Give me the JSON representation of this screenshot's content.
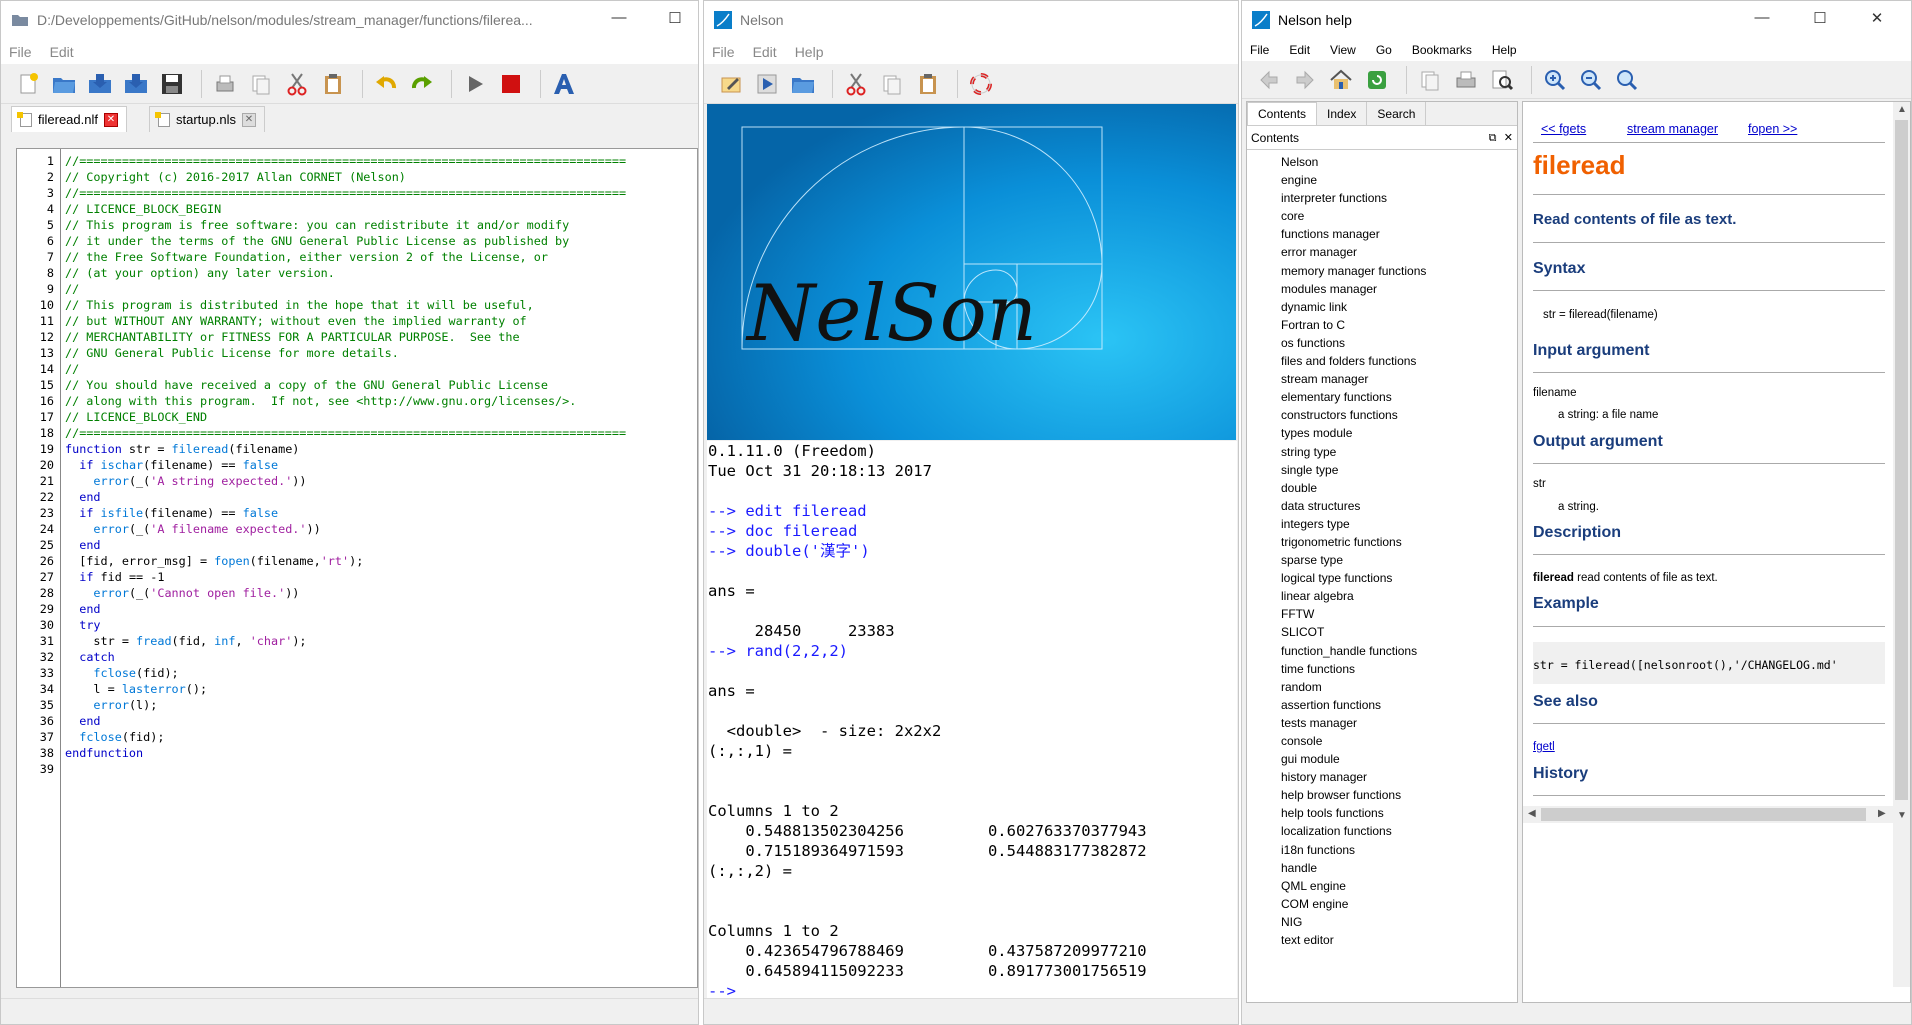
{
  "editor": {
    "title": "D:/Developpements/GitHub/nelson/modules/stream_manager/functions/filerea...",
    "menu": [
      "File",
      "Edit"
    ],
    "tabs": [
      {
        "label": "fileread.nlf",
        "active": true
      },
      {
        "label": "startup.nls",
        "active": false
      }
    ],
    "line_numbers": [
      "1",
      "2",
      "3",
      "4",
      "5",
      "6",
      "7",
      "8",
      "9",
      "10",
      "11",
      "12",
      "13",
      "14",
      "15",
      "16",
      "17",
      "18",
      "19",
      "20",
      "21",
      "22",
      "23",
      "24",
      "25",
      "26",
      "27",
      "28",
      "29",
      "30",
      "31",
      "32",
      "33",
      "34",
      "35",
      "36",
      "37",
      "38",
      "39"
    ],
    "code_lines": [
      "//=============================================================================",
      "// Copyright (c) 2016-2017 Allan CORNET (Nelson)",
      "//=============================================================================",
      "// LICENCE_BLOCK_BEGIN",
      "// This program is free software: you can redistribute it and/or modify",
      "// it under the terms of the GNU General Public License as published by",
      "// the Free Software Foundation, either version 2 of the License, or",
      "// (at your option) any later version.",
      "//",
      "// This program is distributed in the hope that it will be useful,",
      "// but WITHOUT ANY WARRANTY; without even the implied warranty of",
      "// MERCHANTABILITY or FITNESS FOR A PARTICULAR PURPOSE.  See the",
      "// GNU General Public License for more details.",
      "//",
      "// You should have received a copy of the GNU General Public License",
      "// along with this program.  If not, see <http://www.gnu.org/licenses/>.",
      "// LICENCE_BLOCK_END",
      "//=============================================================================",
      "function str = fileread(filename)",
      "  if ischar(filename) == false",
      "    error(_('A string expected.'))",
      "  end",
      "  if isfile(filename) == false",
      "    error(_('A filename expected.'))",
      "  end",
      "  [fid, error_msg] = fopen(filename,'rt');",
      "  if fid == -1",
      "    error(_('Cannot open file.'))",
      "  end",
      "  try",
      "    str = fread(fid, inf, 'char');",
      "  catch",
      "    fclose(fid);",
      "    l = lasterror();",
      "    error(l);",
      "  end",
      "  fclose(fid);",
      "endfunction",
      ""
    ]
  },
  "console": {
    "title": "Nelson",
    "menu": [
      "File",
      "Edit",
      "Help"
    ],
    "banner_text": "NelSon",
    "lines": [
      {
        "t": "0.1.11.0 (Freedom)",
        "p": false
      },
      {
        "t": "Tue Oct 31 20:18:13 2017",
        "p": false
      },
      {
        "t": "",
        "p": false
      },
      {
        "t": "--> edit fileread",
        "p": true
      },
      {
        "t": "--> doc fileread",
        "p": true
      },
      {
        "t": "--> double('漢字')",
        "p": true
      },
      {
        "t": "",
        "p": false
      },
      {
        "t": "ans =",
        "p": false
      },
      {
        "t": "",
        "p": false
      },
      {
        "t": "     28450     23383",
        "p": false
      },
      {
        "t": "--> rand(2,2,2)",
        "p": true
      },
      {
        "t": "",
        "p": false
      },
      {
        "t": "ans =",
        "p": false
      },
      {
        "t": "",
        "p": false
      },
      {
        "t": "  <double>  - size: 2x2x2",
        "p": false
      },
      {
        "t": "(:,:,1) =",
        "p": false
      },
      {
        "t": "",
        "p": false
      },
      {
        "t": "",
        "p": false
      },
      {
        "t": "Columns 1 to 2",
        "p": false
      },
      {
        "t": "    0.548813502304256         0.602763370377943",
        "p": false
      },
      {
        "t": "    0.715189364971593         0.544883177382872",
        "p": false
      },
      {
        "t": "(:,:,2) =",
        "p": false
      },
      {
        "t": "",
        "p": false
      },
      {
        "t": "",
        "p": false
      },
      {
        "t": "Columns 1 to 2",
        "p": false
      },
      {
        "t": "    0.423654796788469         0.437587209977210",
        "p": false
      },
      {
        "t": "    0.645894115092233         0.891773001756519",
        "p": false
      },
      {
        "t": "-->",
        "p": true
      }
    ]
  },
  "help": {
    "title": "Nelson help",
    "menu": [
      "File",
      "Edit",
      "View",
      "Go",
      "Bookmarks",
      "Help"
    ],
    "tabs": [
      "Contents",
      "Index",
      "Search"
    ],
    "contents_header": "Contents",
    "contents": [
      "Nelson",
      "engine",
      "interpreter functions",
      "core",
      "functions manager",
      "error manager",
      "memory manager functions",
      "modules manager",
      "dynamic link",
      "Fortran to C",
      "os functions",
      "files and folders functions",
      "stream manager",
      "elementary functions",
      "constructors functions",
      "types module",
      "string type",
      "single type",
      "double",
      "data structures",
      "integers type",
      "trigonometric functions",
      "sparse type",
      "logical type functions",
      "linear algebra",
      "FFTW",
      "SLICOT",
      "function_handle functions",
      "time functions",
      "random",
      "assertion functions",
      "tests manager",
      "console",
      "gui module",
      "history manager",
      "help browser functions",
      "help tools functions",
      "localization functions",
      "i18n functions",
      "handle",
      "QML engine",
      "COM engine",
      "NIG",
      "text editor"
    ],
    "nav_prev": "<< fgets",
    "nav_up": "stream manager",
    "nav_next": "fopen >>",
    "page_title": "fileread",
    "summary": "Read contents of file as text.",
    "syntax_h": "Syntax",
    "syntax": "str = fileread(filename)",
    "input_h": "Input argument",
    "input_name": "filename",
    "input_desc": "a string: a file name",
    "output_h": "Output argument",
    "output_name": "str",
    "output_desc": "a string.",
    "desc_h": "Description",
    "desc_bold": "fileread",
    "desc_text": " read contents of file as text.",
    "example_h": "Example",
    "example_code": "str = fileread([nelsonroot(),'/CHANGELOG.md'",
    "seealso_h": "See also",
    "seealso_link": "fgetl",
    "history_h": "History"
  }
}
